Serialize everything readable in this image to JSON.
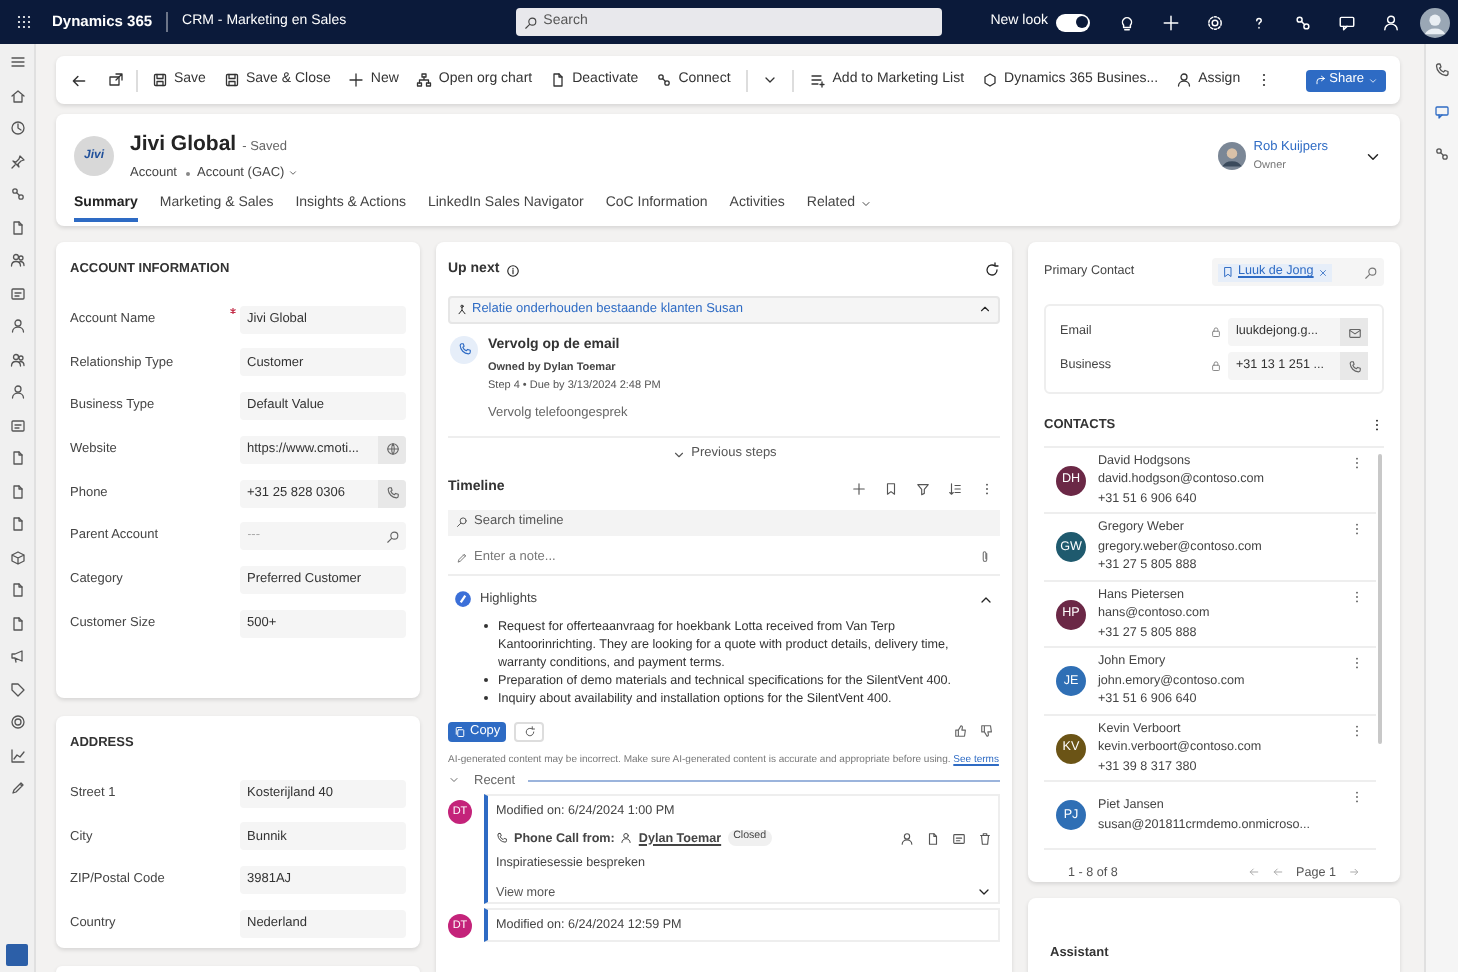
{
  "top_bar": {
    "app_name": "Dynamics 365",
    "area": "CRM - Marketing en Sales",
    "search_placeholder": "Search",
    "new_look_label": "New look",
    "new_look_on": true
  },
  "commands": [
    {
      "label": "Save",
      "kind": "button"
    },
    {
      "label": "Save & Close",
      "kind": "button"
    },
    {
      "label": "New",
      "kind": "button"
    },
    {
      "label": "Open org chart",
      "kind": "button"
    },
    {
      "label": "Deactivate",
      "kind": "button"
    },
    {
      "label": "Connect",
      "kind": "split"
    },
    {
      "label": "Add to Marketing List",
      "kind": "button"
    },
    {
      "label": "Dynamics 365 Busines...",
      "kind": "button"
    },
    {
      "label": "Assign",
      "kind": "button"
    }
  ],
  "share_button": "Share",
  "header": {
    "logo_text": "Jivi",
    "title": "Jivi Global",
    "saved": "- Saved",
    "entity": "Account",
    "form": "Account (GAC)",
    "owner_name": "Rob Kuijpers",
    "owner_role": "Owner"
  },
  "tabs": [
    {
      "label": "Summary",
      "selected": true,
      "menu": false
    },
    {
      "label": "Marketing & Sales",
      "selected": false,
      "menu": false
    },
    {
      "label": "Insights & Actions",
      "selected": false,
      "menu": false
    },
    {
      "label": "LinkedIn Sales Navigator",
      "selected": false,
      "menu": false
    },
    {
      "label": "CoC Information",
      "selected": false,
      "menu": false
    },
    {
      "label": "Activities",
      "selected": false,
      "menu": false
    },
    {
      "label": "Related",
      "selected": false,
      "menu": true
    }
  ],
  "account_info": {
    "title": "ACCOUNT INFORMATION",
    "fields": [
      {
        "label": "Account Name",
        "value": "Jivi Global",
        "required": true,
        "kind": "text"
      },
      {
        "label": "Relationship Type",
        "value": "Customer",
        "required": false,
        "kind": "text"
      },
      {
        "label": "Business Type",
        "value": "Default Value",
        "required": false,
        "kind": "text"
      },
      {
        "label": "Website",
        "value": "https://www.cmoti...",
        "required": false,
        "kind": "link"
      },
      {
        "label": "Phone",
        "value": "+31 25 828 0306",
        "required": false,
        "kind": "phone"
      },
      {
        "label": "Parent Account",
        "placeholder": "---",
        "required": false,
        "kind": "lookup"
      },
      {
        "label": "Category",
        "value": "Preferred Customer",
        "required": false,
        "kind": "text"
      },
      {
        "label": "Customer Size",
        "value": "500+",
        "required": false,
        "kind": "text"
      }
    ]
  },
  "address": {
    "title": "ADDRESS",
    "fields": [
      {
        "label": "Street 1",
        "value": "Kosterijland 40"
      },
      {
        "label": "City",
        "value": "Bunnik"
      },
      {
        "label": "ZIP/Postal Code",
        "value": "3981AJ"
      },
      {
        "label": "Country",
        "value": "Nederland"
      }
    ]
  },
  "up_next": {
    "title": "Up next",
    "sequence": "Relatie onderhouden bestaande klanten Susan",
    "activity_title": "Vervolg op de email",
    "owner": "Owned by Dylan Toemar",
    "due": "Step 4 • Due by 3/13/2024 2:48 PM",
    "description": "Vervolg telefoongesprek",
    "previous_steps": "Previous steps"
  },
  "timeline": {
    "title": "Timeline",
    "search_placeholder": "Search timeline",
    "note_placeholder": "Enter a note...",
    "highlights": {
      "title": "Highlights",
      "items": [
        "Request for offerteaanvraag for hoekbank Lotta received from Van Terp Kantoorinrichting. They are looking for a quote with product details, delivery time, warranty conditions, and payment terms.",
        "Preparation of demo materials and technical specifications for the SilentVent 400.",
        "Inquiry about availability and installation options for the SilentVent 400."
      ],
      "copy": "Copy",
      "disclaimer": "AI-generated content may be incorrect. Make sure AI-generated content is accurate and appropriate before using.",
      "terms_link": "See terms"
    },
    "recent_label": "Recent",
    "entries": [
      {
        "initials": "DT",
        "modified": "Modified on: 6/24/2024 1:00 PM",
        "type": "Phone Call from:",
        "person": "Dylan Toemar",
        "status": "Closed",
        "subject": "Inspiratiesessie bespreken",
        "view_more": "View more"
      },
      {
        "initials": "DT",
        "modified": "Modified on: 6/24/2024 12:59 PM"
      }
    ]
  },
  "primary_contact": {
    "label": "Primary Contact",
    "value": "Luuk de Jong"
  },
  "contact_fields": [
    {
      "label": "Email",
      "value": "luukdejong.g...",
      "kind": "email"
    },
    {
      "label": "Business",
      "value": "+31 13 1 251 ...",
      "kind": "phone"
    }
  ],
  "contacts": {
    "title": "CONTACTS",
    "items": [
      {
        "initials": "DH",
        "name": "David Hodgsons",
        "email": "david.hodgson@contoso.com",
        "phone": "+31 51 6 906 640",
        "color": "#6b2846"
      },
      {
        "initials": "GW",
        "name": "Gregory Weber",
        "email": "gregory.weber@contoso.com",
        "phone": "+31 27 5 805 888",
        "color": "#1f5a6e"
      },
      {
        "initials": "HP",
        "name": "Hans Pietersen",
        "email": "hans@contoso.com",
        "phone": "+31 27 5 805 888",
        "color": "#6b2846"
      },
      {
        "initials": "JE",
        "name": "John Emory",
        "email": "john.emory@contoso.com",
        "phone": "+31 51 6 906 640",
        "color": "#2f6fb5"
      },
      {
        "initials": "KV",
        "name": "Kevin Verboort",
        "email": "kevin.verboort@contoso.com",
        "phone": "+31 39 8 317 380",
        "color": "#6b5416"
      },
      {
        "initials": "PJ",
        "name": "Piet Jansen",
        "email": "susan@201811crmdemo.onmicroso...",
        "color": "#2f6fb5"
      }
    ],
    "pager": "1 - 8 of 8",
    "page": "Page 1"
  },
  "assistant": "Assistant"
}
